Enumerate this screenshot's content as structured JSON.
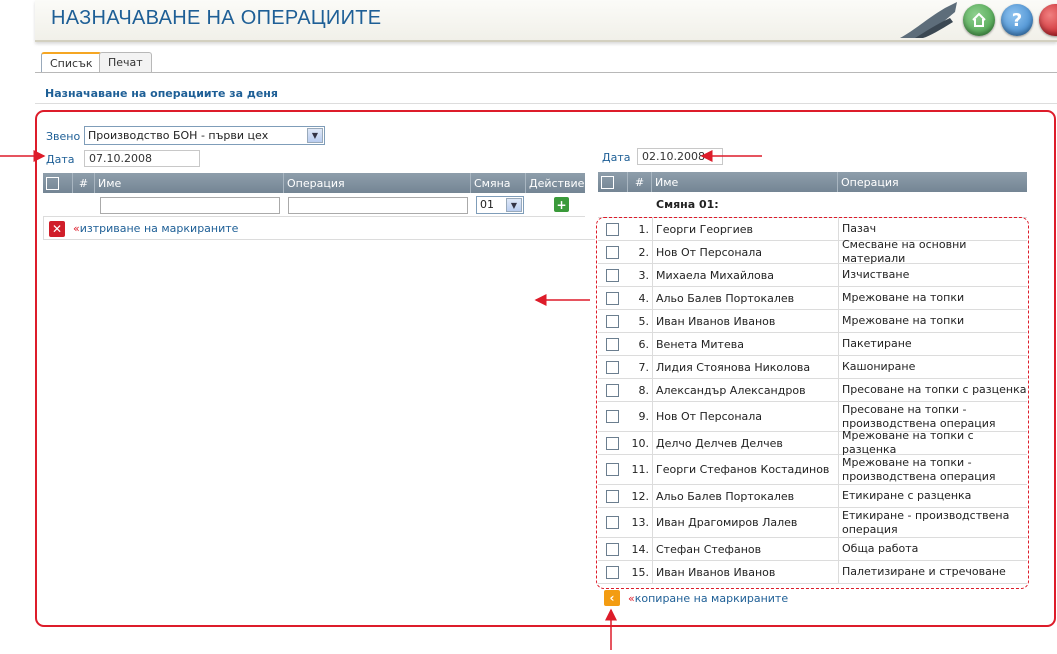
{
  "header": {
    "title": "НАЗНАЧАВАНЕ НА ОПЕРАЦИИТЕ",
    "home_icon": "home-icon",
    "help_icon": "help-icon",
    "close_icon": "close-icon"
  },
  "tabs": [
    {
      "label": "Списък",
      "active": true
    },
    {
      "label": "Печат",
      "active": false
    }
  ],
  "section_title": "Назначаване на операциите за деня",
  "left": {
    "unit_label": "Звено",
    "unit_value": "Производство БОН - първи цех",
    "date_label": "Дата",
    "date_value": "07.10.2008",
    "columns": [
      "#",
      "Име",
      "Операция",
      "Смяна",
      "Действие"
    ],
    "shift_value": "01",
    "delete_link": "изтриване на маркираните",
    "delete_prefix": "«"
  },
  "right": {
    "date_label": "Дата",
    "date_value": "02.10.2008",
    "columns": [
      "#",
      "Име",
      "Операция"
    ],
    "group_title": "Смяна 01:",
    "copy_link": "копиране на маркираните",
    "copy_prefix": "«",
    "rows": [
      {
        "n": "1.",
        "name": "Георги Георгиев",
        "op": "Пазач"
      },
      {
        "n": "2.",
        "name": "Нов От Персонала",
        "op": "Смесване на основни материали"
      },
      {
        "n": "3.",
        "name": "Михаела Михайлова",
        "op": "Изчистване"
      },
      {
        "n": "4.",
        "name": "Альо Балев Портокалев",
        "op": "Мрежоване на топки"
      },
      {
        "n": "5.",
        "name": "Иван Иванов Иванов",
        "op": "Мрежоване на топки"
      },
      {
        "n": "6.",
        "name": "Венета Митева",
        "op": "Пакетиране"
      },
      {
        "n": "7.",
        "name": "Лидия Стоянова Николова",
        "op": "Кашониране"
      },
      {
        "n": "8.",
        "name": "Александър Александров",
        "op": "Пресоване на топки с разценка"
      },
      {
        "n": "9.",
        "name": "Нов От Персонала",
        "op": "Пресоване на топки -",
        "op2": "производствена операция"
      },
      {
        "n": "10.",
        "name": "Делчо Делчев Делчев",
        "op": "Мрежоване на топки с разценка"
      },
      {
        "n": "11.",
        "name": "Георги Стефанов Костадинов",
        "op": "Мрежоване на топки -",
        "op2": "производствена операция"
      },
      {
        "n": "12.",
        "name": "Альо Балев Портокалев",
        "op": "Етикиране с разценка"
      },
      {
        "n": "13.",
        "name": "Иван Драгомиров Лалев",
        "op": "Етикиране - производствена",
        "op2": "операция"
      },
      {
        "n": "14.",
        "name": "Стефан Стефанов",
        "op": "Обща работа"
      },
      {
        "n": "15.",
        "name": "Иван Иванов Иванов",
        "op": "Палетизиране и стречоване"
      }
    ]
  },
  "colors": {
    "title_blue": "#1e5f96",
    "annotation_red": "#dd1c2a",
    "header_bar": "#8e9eab"
  }
}
